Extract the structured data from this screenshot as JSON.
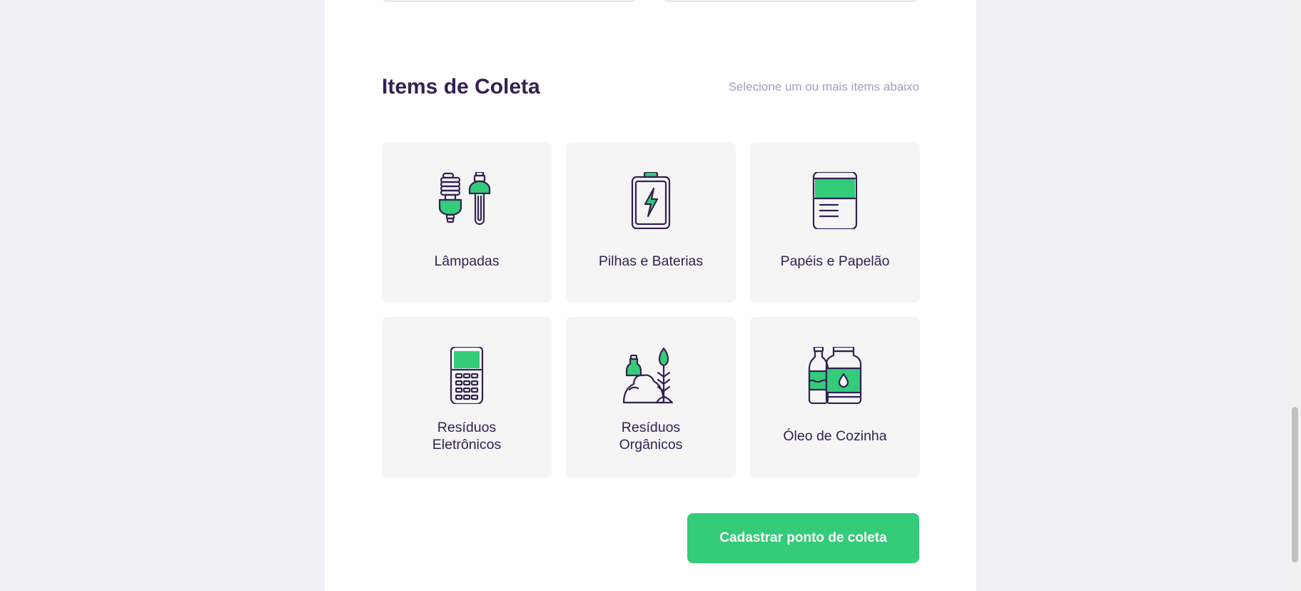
{
  "section": {
    "title": "Items de Coleta",
    "hint": "Selecione um ou mais items abaixo"
  },
  "items": [
    {
      "label": "Lâmpadas",
      "icon": "lamps-icon"
    },
    {
      "label": "Pilhas e Baterias",
      "icon": "battery-icon"
    },
    {
      "label": "Papéis e Papelão",
      "icon": "paper-icon"
    },
    {
      "label": "Resíduos Eletrônicos",
      "icon": "electronics-icon"
    },
    {
      "label": "Resíduos Orgânicos",
      "icon": "organic-waste-icon"
    },
    {
      "label": "Óleo de Cozinha",
      "icon": "cooking-oil-icon"
    }
  ],
  "submit": {
    "label": "Cadastrar ponto de coleta"
  },
  "colors": {
    "primary": "#34cb79",
    "title": "#322153",
    "hint": "#a69cbf",
    "background": "#f0f0f5",
    "item_background": "#f5f5f5"
  }
}
